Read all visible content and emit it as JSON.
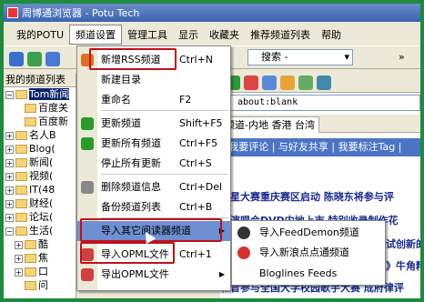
{
  "window": {
    "title": "周博通浏览器 - Potu Tech"
  },
  "menubar": [
    "我的POTU",
    "频道设置",
    "管理工具",
    "显示",
    "收藏夹",
    "推荐频道列表",
    "帮助"
  ],
  "search": {
    "placeholder": "搜索 -"
  },
  "sidebar": {
    "header": "我的频道列表",
    "items": [
      {
        "label": "Tom新闻",
        "expander": "⊟",
        "selected": true,
        "indent": 0
      },
      {
        "label": "百度关",
        "expander": "",
        "indent": 1
      },
      {
        "label": "百度新",
        "expander": "",
        "indent": 1
      },
      {
        "label": "名人B",
        "expander": "⊞",
        "indent": 0
      },
      {
        "label": "Blog(",
        "expander": "⊞",
        "indent": 0
      },
      {
        "label": "新闻(",
        "expander": "⊞",
        "indent": 0
      },
      {
        "label": "视频(",
        "expander": "⊞",
        "indent": 0
      },
      {
        "label": "IT(48",
        "expander": "⊞",
        "indent": 0
      },
      {
        "label": "财经(",
        "expander": "⊞",
        "indent": 0
      },
      {
        "label": "论坛(",
        "expander": "⊞",
        "indent": 0
      },
      {
        "label": "生活(",
        "expander": "⊟",
        "indent": 0
      },
      {
        "label": "酷",
        "expander": "⊞",
        "indent": 1
      },
      {
        "label": "焦",
        "expander": "⊞",
        "indent": 1
      },
      {
        "label": "口",
        "expander": "⊞",
        "indent": 1
      },
      {
        "label": "问",
        "expander": "",
        "indent": 1
      }
    ]
  },
  "address": {
    "value": "about:blank"
  },
  "tab": {
    "label": "频道-内地 香港 台湾"
  },
  "actionbar": {
    "text": "| 我要评论 | 与好友共享 | 我要标注Tag |"
  },
  "news": [
    "新星大赛重庆赛区启动  陈晓东将参与评",
    "",
    "音演唱会DVD内地上市 特别收录制作花",
    "",
    "试创新的歌",
    "》牛角精",
    "和音参与全国大学校园歌手大赛 成府律评"
  ],
  "menu": {
    "items": [
      {
        "label": "新增RSS频道",
        "shortcut": "Ctrl+N",
        "icon": "rss-icon",
        "color": "#e07020"
      },
      {
        "label": "新建目录",
        "shortcut": "",
        "icon": "",
        "color": ""
      },
      {
        "label": "重命名",
        "shortcut": "F2",
        "icon": "",
        "color": ""
      },
      {
        "label": "更新频道",
        "shortcut": "Shift+F5",
        "icon": "refresh-icon",
        "color": "#2a9a2a"
      },
      {
        "label": "更新所有频道",
        "shortcut": "Ctrl+F5",
        "icon": "refresh-all-icon",
        "color": "#2a9a2a"
      },
      {
        "label": "停止所有更新",
        "shortcut": "Ctrl+S",
        "icon": "",
        "color": ""
      },
      {
        "label": "删除频道信息",
        "shortcut": "Ctrl+Del",
        "icon": "delete-icon",
        "color": "#888888"
      },
      {
        "label": "备份频道列表",
        "shortcut": "Ctrl+B",
        "icon": "",
        "color": ""
      },
      {
        "label": "导入其它阅读器频道",
        "shortcut": "",
        "icon": "",
        "color": "",
        "submenu": true,
        "highlighted": true
      },
      {
        "label": "导入OPML文件",
        "shortcut": "Ctrl+1",
        "icon": "import-icon",
        "color": "#d04040"
      },
      {
        "label": "导出OPML文件",
        "shortcut": "",
        "icon": "export-icon",
        "color": "#d04040",
        "submenu": true
      }
    ]
  },
  "submenu": {
    "items": [
      {
        "label": "导入FeedDemon频道",
        "icon": "feeddemon-icon",
        "color": "#333333"
      },
      {
        "label": "导入新浪点点通频道",
        "icon": "sina-icon",
        "color": "#d83030"
      },
      {
        "label": "Bloglines Feeds",
        "icon": "",
        "color": ""
      }
    ]
  },
  "colors": {
    "highlight": "#6e8fd1",
    "annotation": "#c0101a",
    "background": "#1e8a3c"
  }
}
